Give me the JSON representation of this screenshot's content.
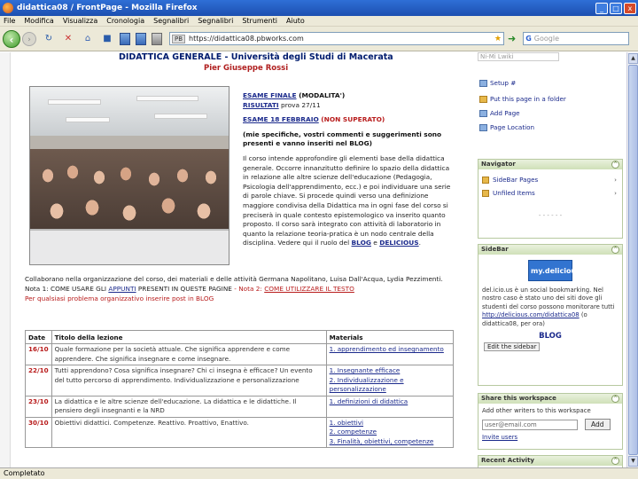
{
  "window": {
    "title": "didattica08 / FrontPage - Mozilla Firefox",
    "minimize": "_",
    "maximize": "□",
    "close": "x"
  },
  "menu": [
    "File",
    "Modifica",
    "Visualizza",
    "Cronologia",
    "Segnalibri",
    "Segnalibri",
    "Strumenti",
    "Aiuto"
  ],
  "nav": {
    "url_prefix": "PB",
    "url": "https://didattica08.pbworks.com",
    "search_placeholder": "Google",
    "search_engine_glyph": "G"
  },
  "page": {
    "title": "DIDATTICA GENERALE - Università degli Studi di Macerata",
    "author": "Pier Giuseppe Rossi",
    "exam_final_link": "ESAME FINALE",
    "exam_final_rest": " (MODALITA')",
    "results_link": "RISULTATI",
    "results_rest": " prova 27/11",
    "exam_feb_link": "ESAME 18 FEBBRAIO",
    "exam_feb_rest": " (NON SUPERATO)",
    "comments_note": "(mie specifiche, vostri commenti e suggerimenti sono presenti e vanno inseriti nel BLOG)",
    "course_text_1": "Il corso intende approfondire gli elementi base della didattica generale. Occorre innanzitutto definire lo spazio della didattica in relazione alle altre scienze dell'educazione (Pedagogia, Psicologia dell'apprendimento, ecc.) e poi individuare una serie di parole chiave. Si procede quindi verso una definizione maggiore condivisa della Didattica ma in ogni fase del corso si preciserà in quale contesto epistemologico va inserito quanto proposto. Il corso sarà integrato con attività di laboratorio in quanto la relazione teoria-pratica è un nodo centrale della disciplina. Vedere qui il ruolo del ",
    "blog_word": "BLOG",
    "and_word": " e ",
    "delicious_word": "DELICIOUS",
    "collab_text": "Collaborano nella organizzazione del corso, dei materiali e delle attività Germana Napolitano, Luisa Dall'Acqua, Lydia Pezzimenti.",
    "note1_prefix": "Nota 1: COME USARE GLI ",
    "note1_link": "APPUNTI",
    "note1_rest": " PRESENTI IN QUESTE PAGINE",
    "note2_prefix": " - Nota 2: ",
    "note2_link": "COME UTILIZZARE IL TESTO",
    "problems_text": "Per qualsiasi problema organizzativo inserire post in BLOG"
  },
  "lessons_table": {
    "headers": [
      "Date",
      "Titolo della lezione",
      "Materials"
    ],
    "rows": [
      {
        "date": "16/10",
        "title": "Quale formazione per la società attuale. Che significa apprendere e come apprendere. Che significa insegnare e come insegnare.",
        "materials": [
          "1. apprendimento ed insegnamento"
        ]
      },
      {
        "date": "22/10",
        "title": "Tutti apprendono? Cosa significa insegnare? Chi ci insegna è efficace? Un evento del tutto percorso di apprendimento. Individualizzazione e personalizzazione",
        "materials": [
          "1. Insegnante efficace",
          "2. Individualizzazione e personalizzazione"
        ]
      },
      {
        "date": "23/10",
        "title": "La didattica e le altre scienze dell'educazione. La didattica e le didattiche. Il pensiero degli insegnanti e la NRD",
        "materials": [
          "1. definizioni di didattica"
        ]
      },
      {
        "date": "30/10",
        "title": "Obiettivi didattici. Competenze. Reattivo. Proattivo, Enattivo.",
        "materials": [
          "1. obiettivi",
          "2. competenze",
          "3. Finalità, obiettivi, competenze"
        ]
      }
    ]
  },
  "sidebar": {
    "top_input": "Ni-Mi Lwiki",
    "links": [
      "Setup #",
      "Put this page in a folder",
      "Add Page",
      "Page Location"
    ],
    "navigator": {
      "title": "Navigator",
      "items": [
        "SideBar Pages",
        "Unfiled Items"
      ],
      "more": "- - - - - -"
    },
    "sidebar_widget": {
      "title": "SideBar",
      "delicious_label": "my.delicious",
      "text": "del.icio.us è un social bookmarking. Nel nostro caso è stato uno dei siti dove gli studenti del corso possono monitorare tutti",
      "link_text": "http://delicious.com/didattica08",
      "text2": "(o didattica08, per ora)",
      "blog_label": "BLOG",
      "edit_button": "Edit the sidebar"
    },
    "share_widget": {
      "title": "Share this workspace",
      "prompt": "Add other writers to this workspace",
      "input_value": "user@email.com",
      "add_button": "Add",
      "link": "Invite users"
    },
    "recent_widget": {
      "title": "Recent Activity"
    }
  },
  "status": {
    "text": "Completato"
  },
  "colors": {
    "title_bar": "#1d4fb0",
    "link": "#1b2a8c",
    "accent_red": "#b81c1c",
    "widget_header": "#cfe0b8"
  }
}
